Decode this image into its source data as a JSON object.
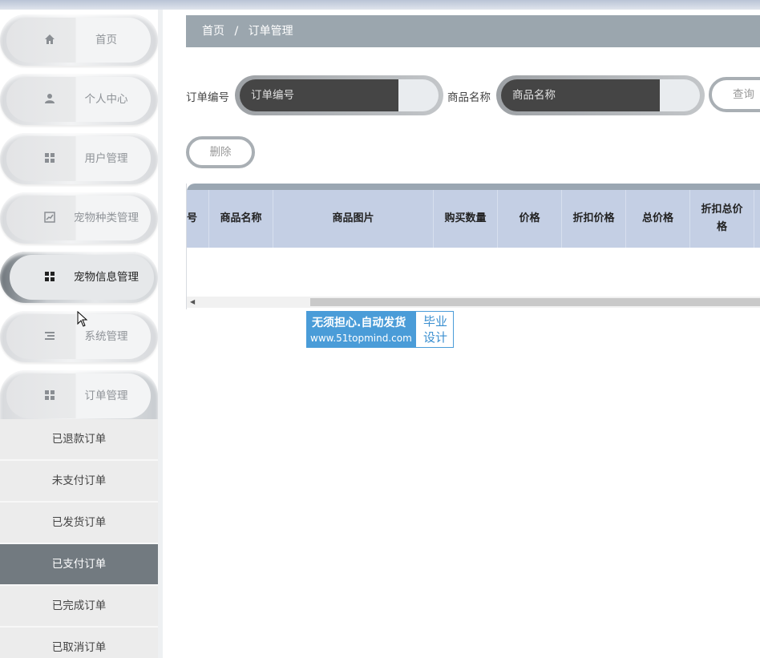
{
  "breadcrumb": {
    "home": "首页",
    "separator": "/",
    "current": "订单管理"
  },
  "sidebar": {
    "items": [
      {
        "label": "首页",
        "icon": "home-icon"
      },
      {
        "label": "个人中心",
        "icon": "user-icon"
      },
      {
        "label": "用户管理",
        "icon": "grid-icon"
      },
      {
        "label": "宠物种类管理",
        "icon": "chart-icon"
      },
      {
        "label": "宠物信息管理",
        "icon": "grid-icon"
      },
      {
        "label": "系统管理",
        "icon": "list-icon"
      },
      {
        "label": "订单管理",
        "icon": "grid-icon"
      }
    ],
    "submenu": [
      "已退款订单",
      "未支付订单",
      "已发货订单",
      "已支付订单",
      "已完成订单",
      "已取消订单"
    ]
  },
  "search": {
    "order_no_label": "订单编号",
    "order_no_placeholder": "订单编号",
    "product_name_label": "商品名称",
    "product_name_placeholder": "商品名称",
    "query_button": "查询"
  },
  "actions": {
    "delete_button": "删除"
  },
  "table": {
    "headers": [
      "号",
      "商品名称",
      "商品图片",
      "购买数量",
      "价格",
      "折扣价格",
      "总价格",
      "折扣总价格"
    ]
  },
  "promo": {
    "line1": "无须担心.自动发货",
    "line2": "www.51topmind.com",
    "badge1": "毕业",
    "badge2": "设计"
  },
  "colors": {
    "breadcrumb_bg": "#9ba6ae",
    "table_header_bg": "#c4cfe4",
    "active_submenu_bg": "#727a80"
  }
}
